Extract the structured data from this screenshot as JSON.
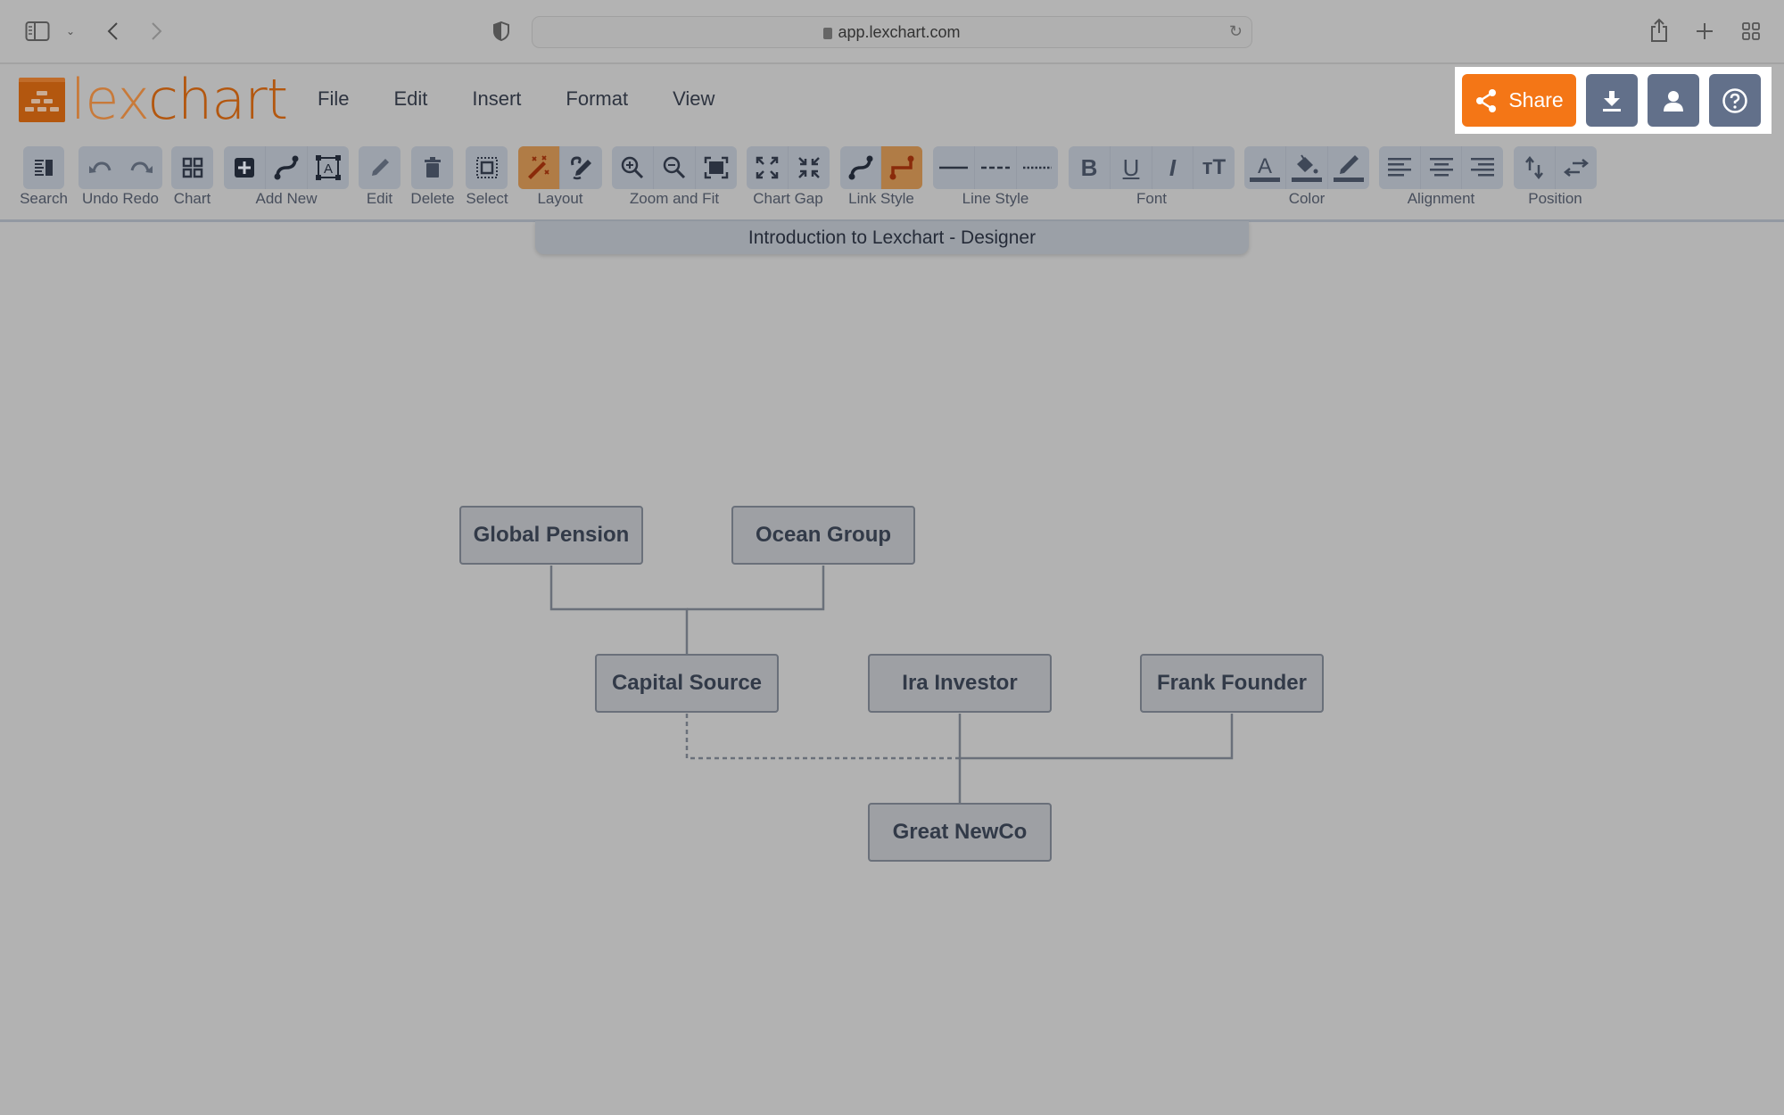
{
  "browser": {
    "url": "app.lexchart.com",
    "icons": [
      "sidebar-icon",
      "chevron-down-icon",
      "back-icon",
      "forward-icon",
      "shield-icon",
      "lock-icon",
      "reload-icon",
      "share-icon",
      "new-tab-icon",
      "tab-overview-icon"
    ]
  },
  "app": {
    "logo_part1": "lex",
    "logo_part2": "chart",
    "menu": [
      "File",
      "Edit",
      "Insert",
      "Format",
      "View"
    ],
    "share_label": "Share",
    "colors": {
      "accent": "#f47616",
      "brand": "#b3570f",
      "button": "#62708a",
      "active": "#b07c46"
    }
  },
  "toolbar": {
    "groups": [
      {
        "label": "Search"
      },
      {
        "label": "Undo Redo"
      },
      {
        "label": "Chart"
      },
      {
        "label": "Add New"
      },
      {
        "label": "Edit"
      },
      {
        "label": "Delete"
      },
      {
        "label": "Select"
      },
      {
        "label": "Layout"
      },
      {
        "label": "Zoom and Fit"
      },
      {
        "label": "Chart Gap"
      },
      {
        "label": "Link Style"
      },
      {
        "label": "Line Style"
      },
      {
        "label": "Font"
      },
      {
        "label": "Color"
      },
      {
        "label": "Alignment"
      },
      {
        "label": "Position"
      }
    ]
  },
  "document": {
    "title": "Introduction to Lexchart - Designer"
  },
  "chart": {
    "nodes": [
      {
        "id": "gp",
        "label": "Global Pension"
      },
      {
        "id": "og",
        "label": "Ocean Group"
      },
      {
        "id": "cs",
        "label": "Capital Source"
      },
      {
        "id": "ii",
        "label": "Ira Investor"
      },
      {
        "id": "ff",
        "label": "Frank Founder"
      },
      {
        "id": "gn",
        "label": "Great NewCo"
      }
    ],
    "links": [
      {
        "from": "gp",
        "to": "cs",
        "style": "solid"
      },
      {
        "from": "og",
        "to": "cs",
        "style": "solid"
      },
      {
        "from": "cs",
        "to": "gn",
        "style": "dashed"
      },
      {
        "from": "ii",
        "to": "gn",
        "style": "solid"
      },
      {
        "from": "ff",
        "to": "gn",
        "style": "solid"
      }
    ]
  }
}
